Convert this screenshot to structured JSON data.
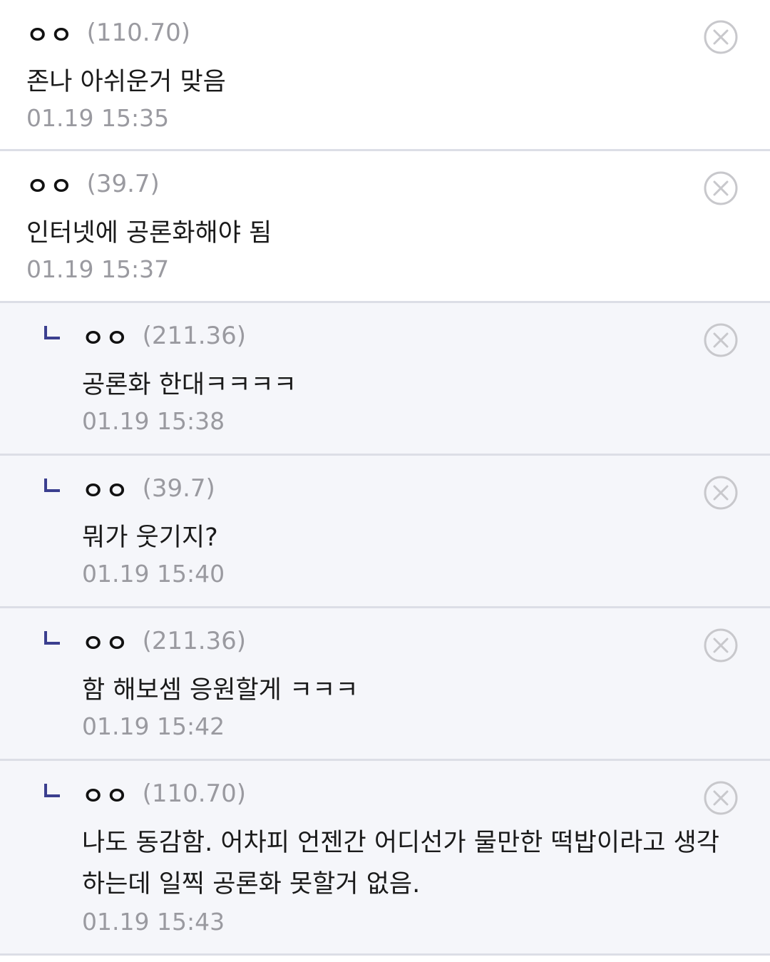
{
  "comments": [
    {
      "nick": "ㅇㅇ",
      "ip": "(110.70)",
      "text": "존나 아쉬운거 맞음",
      "time": "01.19 15:35"
    },
    {
      "nick": "ㅇㅇ",
      "ip": "(39.7)",
      "text": "인터넷에 공론화해야 됨",
      "time": "01.19 15:37"
    }
  ],
  "replies": [
    {
      "nick": "ㅇㅇ",
      "ip": "(211.36)",
      "text": "공론화 한대ㅋㅋㅋㅋ",
      "time": "01.19 15:38"
    },
    {
      "nick": "ㅇㅇ",
      "ip": "(39.7)",
      "text": "뭐가 웃기지?",
      "time": "01.19 15:40"
    },
    {
      "nick": "ㅇㅇ",
      "ip": "(211.36)",
      "text": "함 해보셈 응원할게 ㅋㅋㅋ",
      "time": "01.19 15:42"
    },
    {
      "nick": "ㅇㅇ",
      "ip": "(110.70)",
      "text": "나도 동감함. 어차피 언젠간 어디선가 물만한 떡밥이라고 생각하는데 일찍 공론화 못할거 없음.",
      "time": "01.19 15:43"
    }
  ],
  "icons": {
    "delete": "close-circle-icon",
    "reply": "reply-arrow-icon"
  },
  "colors": {
    "reply_background": "#f5f6fa",
    "reply_mark": "#3b3f8f",
    "muted_text": "#9a9aa0",
    "divider": "#dcdee6"
  }
}
